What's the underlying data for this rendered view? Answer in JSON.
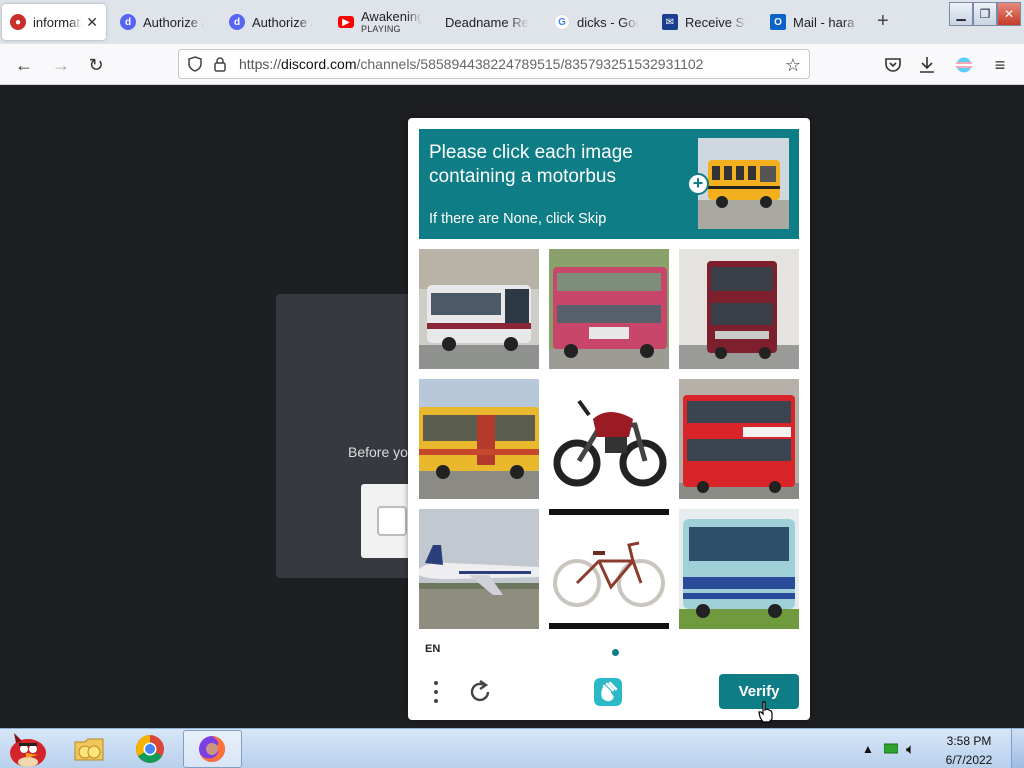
{
  "browser": {
    "tabs": [
      {
        "label": "informati",
        "icon": "red-circle-icon",
        "color": "#c9302c",
        "active": true
      },
      {
        "label": "Authorize a",
        "icon": "discord-icon",
        "color": "#5865f2"
      },
      {
        "label": "Authorize a",
        "icon": "discord-icon",
        "color": "#5865f2"
      },
      {
        "label": "Awakening",
        "sub": "PLAYING",
        "icon": "youtube-icon",
        "color": "#ff0000"
      },
      {
        "label": "Deadname Rem",
        "icon": "none"
      },
      {
        "label": "dicks - Goo",
        "icon": "google-icon",
        "color": "#4285f4"
      },
      {
        "label": "Receive SM",
        "icon": "sms-icon",
        "color": "#1a3f8f"
      },
      {
        "label": "Mail - hara",
        "icon": "outlook-icon",
        "color": "#0a64c8"
      }
    ],
    "url": {
      "prefix": "https://",
      "host": "discord.com",
      "path": "/channels/585894438224789515/835793251532931102"
    }
  },
  "page": {
    "background_text": "Before yo"
  },
  "captcha": {
    "prompt_line1": "Please click each image",
    "prompt_line2": "containing a motorbus",
    "skip_hint": "If there are None, click Skip",
    "example_icon": "school-bus-image",
    "images": [
      {
        "name": "grey-city-bus-image"
      },
      {
        "name": "pink-double-decker-bus-image"
      },
      {
        "name": "maroon-double-decker-bus-image"
      },
      {
        "name": "yellow-bus-image"
      },
      {
        "name": "motorcycle-image"
      },
      {
        "name": "red-double-decker-bus-image"
      },
      {
        "name": "airplane-image"
      },
      {
        "name": "bicycle-image"
      },
      {
        "name": "blue-bus-image"
      }
    ],
    "language": "EN",
    "verify_label": "Verify",
    "accent": "#0f7d86"
  },
  "taskbar": {
    "time": "3:58 PM",
    "date": "6/7/2022"
  }
}
